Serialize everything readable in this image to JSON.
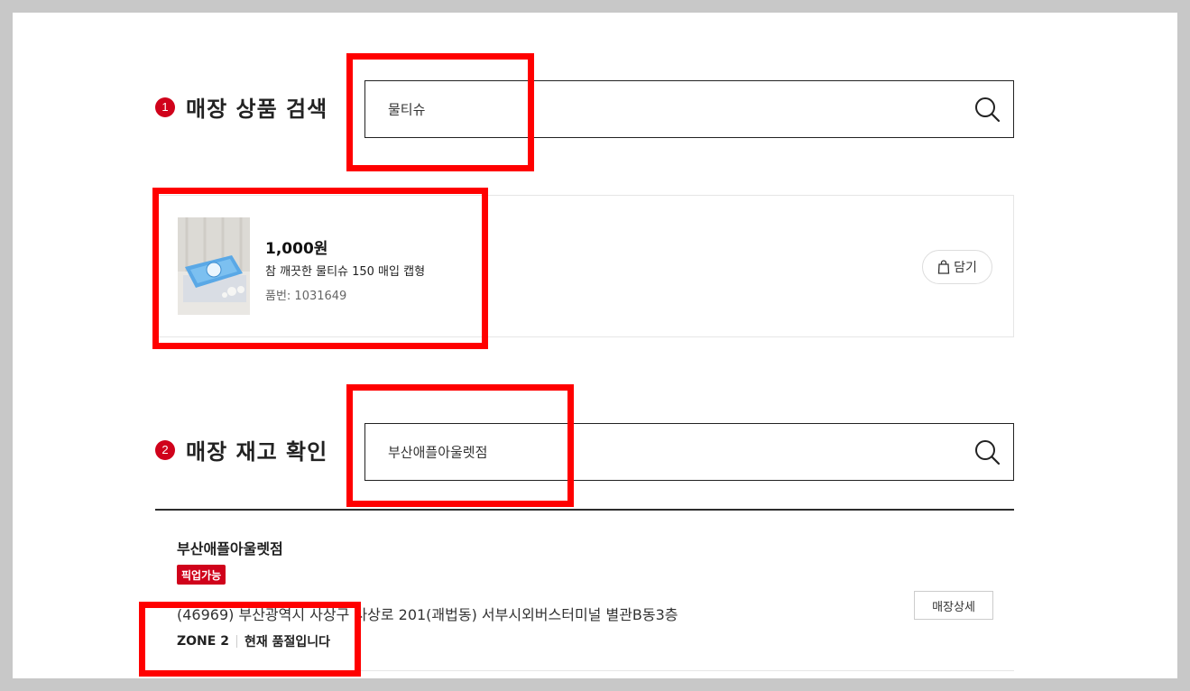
{
  "section1": {
    "number": "1",
    "title": "매장 상품 검색",
    "search_value": "물티슈"
  },
  "product": {
    "price": "1,000원",
    "name": "참 깨끗한 물티슈 150 매입 캡형",
    "code": "품번: 1031649",
    "cart_label": "담기"
  },
  "section2": {
    "number": "2",
    "title": "매장 재고 확인",
    "search_value": "부산애플아울렛점"
  },
  "store": {
    "name": "부산애플아울렛점",
    "badge": "픽업가능",
    "address": "(46969) 부산광역시 사상구 사상로 201(괘법동) 서부시외버스터미널 별관B동3층",
    "zone": "ZONE 2",
    "stock_status": "현재 품절입니다",
    "detail_label": "매장상세"
  },
  "colors": {
    "accent": "#d0021b",
    "highlight": "#ff0000"
  },
  "icons": {
    "search": "search-icon",
    "bag": "shopping-bag-icon"
  }
}
